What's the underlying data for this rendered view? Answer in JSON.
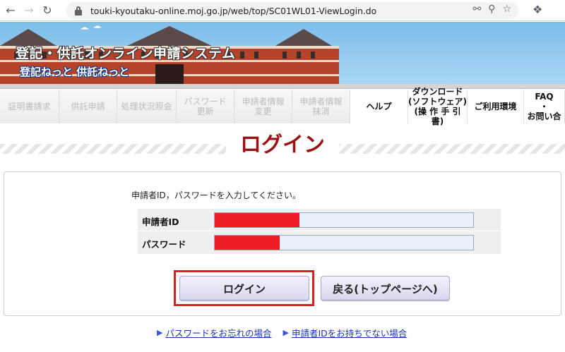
{
  "browser": {
    "url": "touki-kyoutaku-online.moj.go.jp/web/top/SC01WL01-ViewLogin.do"
  },
  "banner": {
    "title": "登記・供託オンライン申請システム",
    "subtitle": "登記ねっと 供託ねっと"
  },
  "nav": {
    "items": [
      {
        "label": "証明書請求",
        "width": 84,
        "active": false
      },
      {
        "label": "供託申請",
        "width": 82,
        "active": false
      },
      {
        "label": "処理状況照会",
        "width": 84,
        "active": false
      },
      {
        "label": "パスワード\n更新",
        "width": 82,
        "active": false
      },
      {
        "label": "申請者情報\n変更",
        "width": 82,
        "active": false
      },
      {
        "label": "申請者情報\n抹消",
        "width": 82,
        "active": false
      },
      {
        "label": "ヘルプ",
        "width": 82,
        "active": true
      },
      {
        "label": "ダウンロード\n(ソフトウェア)\n(操 作 手 引 書)",
        "width": 84,
        "active": true
      },
      {
        "label": "ご利用環境",
        "width": 80,
        "active": true
      },
      {
        "label": "FAQ\n・\nお問い合",
        "width": 58,
        "active": true
      }
    ]
  },
  "page": {
    "heading": "ログイン",
    "instruction": "申請者ID，パスワードを入力してください。"
  },
  "form": {
    "id_label": "申請者ID",
    "password_label": "パスワード"
  },
  "buttons": {
    "login": "ログイン",
    "back": "戻る(トップページへ)"
  },
  "links": {
    "forgot_password": "パスワードをお忘れの場合",
    "no_id": "申請者IDをお持ちでない場合"
  }
}
